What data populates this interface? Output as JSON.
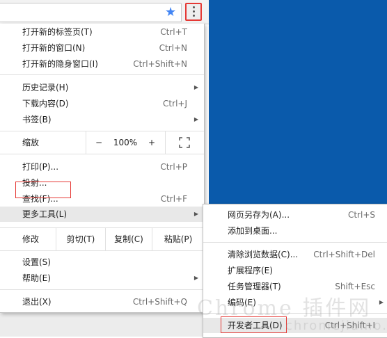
{
  "toolbar": {
    "star_icon": "star-icon",
    "menu_icon": "three-dots-vertical-icon"
  },
  "menu": {
    "new_tab": {
      "label": "打开新的标签页(T)",
      "shortcut": "Ctrl+T"
    },
    "new_window": {
      "label": "打开新的窗口(N)",
      "shortcut": "Ctrl+N"
    },
    "incognito": {
      "label": "打开新的隐身窗口(I)",
      "shortcut": "Ctrl+Shift+N"
    },
    "history": {
      "label": "历史记录(H)"
    },
    "downloads": {
      "label": "下载内容(D)",
      "shortcut": "Ctrl+J"
    },
    "bookmarks": {
      "label": "书签(B)"
    },
    "zoom": {
      "label": "缩放",
      "minus": "−",
      "value": "100%",
      "plus": "+"
    },
    "print": {
      "label": "打印(P)...",
      "shortcut": "Ctrl+P"
    },
    "cast": {
      "label": "投射..."
    },
    "find": {
      "label": "查找(F)...",
      "shortcut": "Ctrl+F"
    },
    "more_tools": {
      "label": "更多工具(L)"
    },
    "edit": {
      "label": "修改",
      "cut": "剪切(T)",
      "copy": "复制(C)",
      "paste": "粘贴(P)"
    },
    "settings": {
      "label": "设置(S)"
    },
    "help": {
      "label": "帮助(E)"
    },
    "exit": {
      "label": "退出(X)",
      "shortcut": "Ctrl+Shift+Q"
    }
  },
  "submenu": {
    "save_page": {
      "label": "网页另存为(A)...",
      "shortcut": "Ctrl+S"
    },
    "add_desktop": {
      "label": "添加到桌面..."
    },
    "clear_data": {
      "label": "清除浏览数据(C)...",
      "shortcut": "Ctrl+Shift+Del"
    },
    "extensions": {
      "label": "扩展程序(E)"
    },
    "task_manager": {
      "label": "任务管理器(T)",
      "shortcut": "Shift+Esc"
    },
    "encoding": {
      "label": "编码(E)"
    },
    "devtools": {
      "label": "开发者工具(D)",
      "shortcut": "Ctrl+Shift+I"
    }
  },
  "watermark": {
    "text": "Chrome 插件网",
    "sub": "chromejiamo.com"
  },
  "colors": {
    "highlight_border": "#e53935",
    "desktop": "#0a5aab",
    "star": "#4285f4"
  }
}
